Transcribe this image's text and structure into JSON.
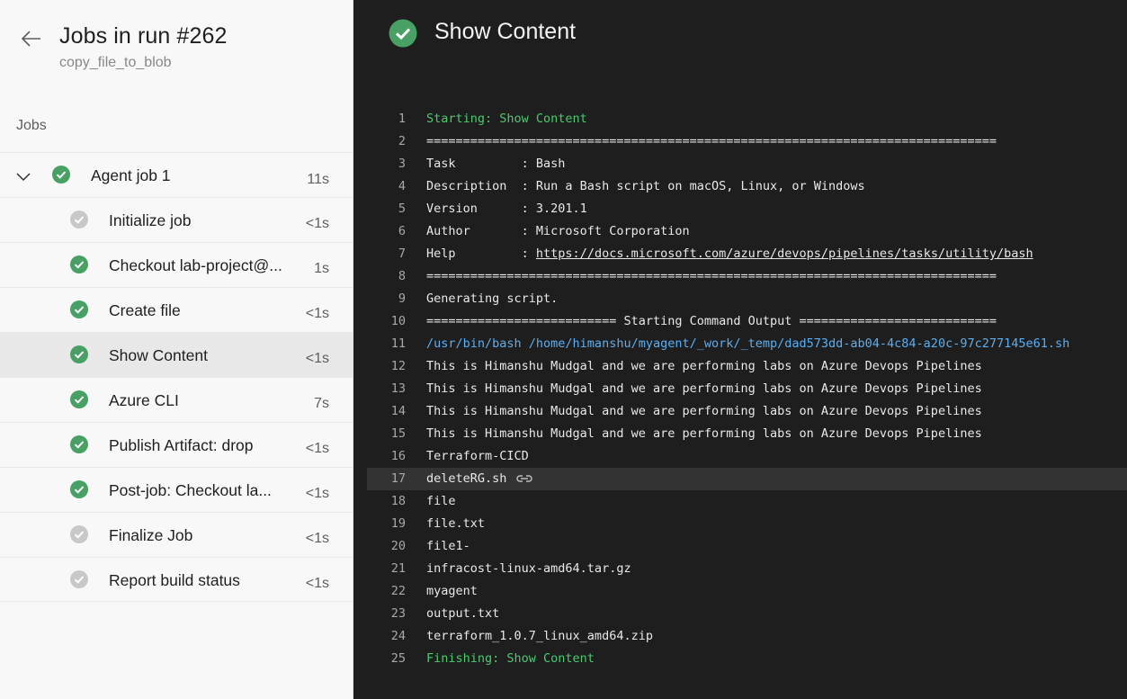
{
  "header": {
    "title": "Jobs in run #262",
    "subtitle": "copy_file_to_blob"
  },
  "sidebar": {
    "section_label": "Jobs",
    "parent_job": {
      "label": "Agent job 1",
      "duration": "11s",
      "status": "success"
    },
    "steps": [
      {
        "label": "Initialize job",
        "duration": "<1s",
        "status": "skipped"
      },
      {
        "label": "Checkout lab-project@...",
        "duration": "1s",
        "status": "success"
      },
      {
        "label": "Create file",
        "duration": "<1s",
        "status": "success"
      },
      {
        "label": "Show Content",
        "duration": "<1s",
        "status": "success",
        "selected": true
      },
      {
        "label": "Azure CLI",
        "duration": "7s",
        "status": "success"
      },
      {
        "label": "Publish Artifact: drop",
        "duration": "<1s",
        "status": "success"
      },
      {
        "label": "Post-job: Checkout la...",
        "duration": "<1s",
        "status": "success"
      },
      {
        "label": "Finalize Job",
        "duration": "<1s",
        "status": "skipped"
      },
      {
        "label": "Report build status",
        "duration": "<1s",
        "status": "skipped"
      }
    ]
  },
  "main": {
    "title": "Show Content",
    "status": "success",
    "log_lines": [
      {
        "n": "1",
        "text": "Starting: Show Content",
        "style": "green"
      },
      {
        "n": "2",
        "text": "==============================================================================",
        "style": ""
      },
      {
        "n": "3",
        "text": "Task         : Bash",
        "style": ""
      },
      {
        "n": "4",
        "text": "Description  : Run a Bash script on macOS, Linux, or Windows",
        "style": ""
      },
      {
        "n": "5",
        "text": "Version      : 3.201.1",
        "style": ""
      },
      {
        "n": "6",
        "text": "Author       : Microsoft Corporation",
        "style": ""
      },
      {
        "n": "7",
        "text": "Help         : ",
        "link": "https://docs.microsoft.com/azure/devops/pipelines/tasks/utility/bash",
        "style": ""
      },
      {
        "n": "8",
        "text": "==============================================================================",
        "style": ""
      },
      {
        "n": "9",
        "text": "Generating script.",
        "style": ""
      },
      {
        "n": "10",
        "text": "========================== Starting Command Output ===========================",
        "style": ""
      },
      {
        "n": "11",
        "text": "/usr/bin/bash /home/himanshu/myagent/_work/_temp/dad573dd-ab04-4c84-a20c-97c277145e61.sh",
        "style": "cmd"
      },
      {
        "n": "12",
        "text": "This is Himanshu Mudgal and we are performing labs on Azure Devops Pipelines",
        "style": ""
      },
      {
        "n": "13",
        "text": "This is Himanshu Mudgal and we are performing labs on Azure Devops Pipelines",
        "style": ""
      },
      {
        "n": "14",
        "text": "This is Himanshu Mudgal and we are performing labs on Azure Devops Pipelines",
        "style": ""
      },
      {
        "n": "15",
        "text": "This is Himanshu Mudgal and we are performing labs on Azure Devops Pipelines",
        "style": ""
      },
      {
        "n": "16",
        "text": "Terraform-CICD",
        "style": ""
      },
      {
        "n": "17",
        "text": "deleteRG.sh",
        "style": "",
        "highlight": true,
        "link_icon": "link-icon"
      },
      {
        "n": "18",
        "text": "file",
        "style": ""
      },
      {
        "n": "19",
        "text": "file.txt",
        "style": ""
      },
      {
        "n": "20",
        "text": "file1-",
        "style": ""
      },
      {
        "n": "21",
        "text": "infracost-linux-amd64.tar.gz",
        "style": ""
      },
      {
        "n": "22",
        "text": "myagent",
        "style": ""
      },
      {
        "n": "23",
        "text": "output.txt",
        "style": ""
      },
      {
        "n": "24",
        "text": "terraform_1.0.7_linux_amd64.zip",
        "style": ""
      },
      {
        "n": "25",
        "text": "Finishing: Show Content",
        "style": "green"
      }
    ]
  },
  "colors": {
    "success": "#48a064",
    "skipped": "#c8c8c8",
    "log_green": "#4ec970",
    "log_cmd": "#5caef0"
  },
  "icons": {
    "back": "arrow-left-icon",
    "expand": "chevron-down-icon",
    "success": "check-circle-icon",
    "skipped": "check-circle-grey-icon",
    "permalink": "link-icon"
  }
}
